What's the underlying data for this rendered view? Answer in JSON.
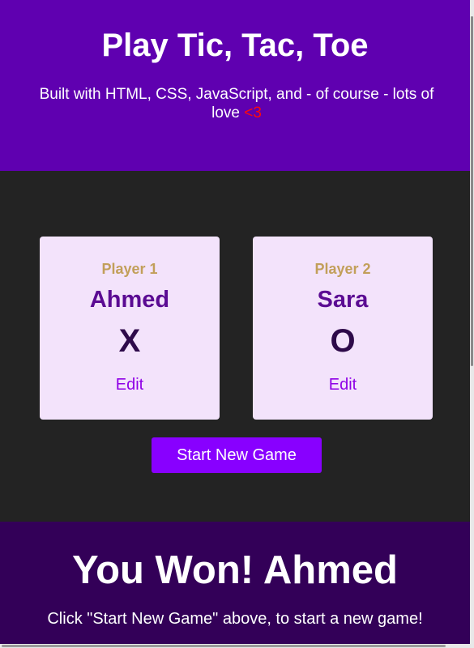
{
  "header": {
    "title": "Play Tic, Tac, Toe",
    "subtitle": "Built with HTML, CSS, JavaScript, and - of course - lots of love ",
    "heart": "<3"
  },
  "players": [
    {
      "label": "Player 1",
      "name": "Ahmed",
      "symbol": "X",
      "edit_label": "Edit"
    },
    {
      "label": "Player 2",
      "name": "Sara",
      "symbol": "O",
      "edit_label": "Edit"
    }
  ],
  "controls": {
    "start_label": "Start New Game"
  },
  "game_over": {
    "title": "You Won! Ahmed",
    "message": "Click \"Start New Game\" above, to start a new game!"
  },
  "colors": {
    "header_bg": "#5f00b0",
    "page_bg": "#232323",
    "card_bg": "#f3e3fb",
    "accent": "#8800ff",
    "heart": "#ff0a0a",
    "game_over_bg": "#330058"
  }
}
